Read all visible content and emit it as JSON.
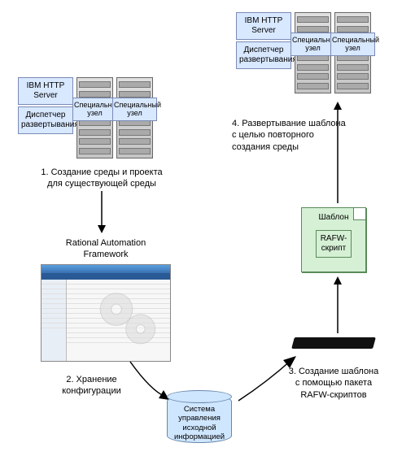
{
  "clusterTop": {
    "stack": {
      "server": "IBM HTTP\nServer",
      "deploy": "Диспетчер\nразвертывания"
    },
    "rack1": "Специальный\nузел",
    "rack2": "Специальный\nузел"
  },
  "clusterRight": {
    "stack": {
      "server": "IBM HTTP\nServer",
      "deploy": "Диспетчер\nразвертывания"
    },
    "rack1": "Специальный\nузел",
    "rack2": "Специальный\nузел"
  },
  "captions": {
    "step1": "1. Создание среды и проекта\nдля существующей среды",
    "rafTitle": "Rational Automation\nFramework",
    "step2": "2. Хранение\nконфигурации",
    "step3": "3. Создание шаблона\nс помощью пакета\nRAFW-скриптов",
    "step4": "4. Развертывание шаблона\nс целью повторного\nсоздания среды"
  },
  "template": {
    "title": "Шаблон",
    "body": "RAFW-\nскрипт"
  },
  "database": "Система\nуправления\nисходной\nинформацией"
}
